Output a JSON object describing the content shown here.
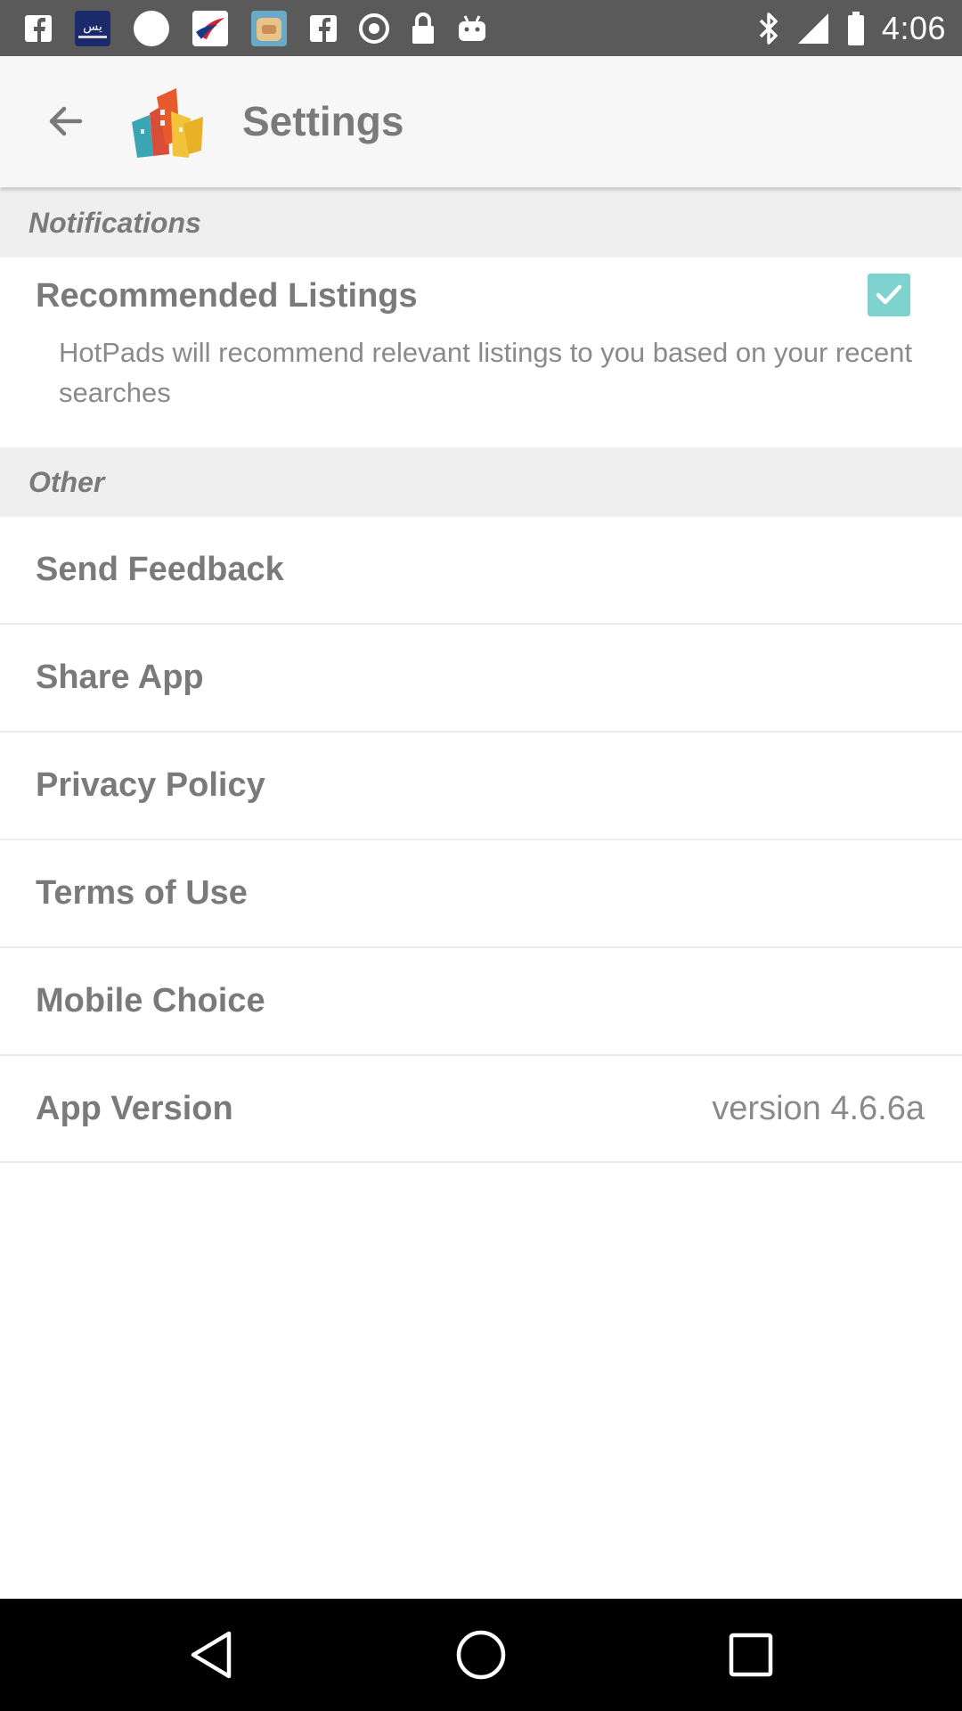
{
  "status_bar": {
    "time": "4:06",
    "icons": [
      "facebook-icon",
      "news-app-icon",
      "circle-icon",
      "airline-app-icon",
      "game-app-icon",
      "facebook-icon",
      "sync-icon",
      "lock-icon",
      "android-icon",
      "bluetooth-icon",
      "signal-icon",
      "battery-icon"
    ]
  },
  "app_bar": {
    "title": "Settings",
    "back_icon": "arrow-back-icon",
    "logo_icon": "hotpads-logo"
  },
  "sections": {
    "notifications": {
      "header": "Notifications"
    },
    "other": {
      "header": "Other"
    }
  },
  "recommended": {
    "title": "Recommended Listings",
    "description": "HotPads will recommend relevant listings to you based on your recent searches",
    "checked": true
  },
  "rows": {
    "send_feedback": "Send Feedback",
    "share_app": "Share App",
    "privacy_policy": "Privacy Policy",
    "terms_of_use": "Terms of Use",
    "mobile_choice": "Mobile Choice",
    "app_version": "App Version",
    "app_version_value": "version 4.6.6a"
  },
  "colors": {
    "status_bar": "#5a5a5a",
    "app_bar": "#f7f7f7",
    "section_bg": "#efefef",
    "text": "#7a7a7a",
    "checkbox": "#7fd3ce",
    "nav_bar": "#000000"
  }
}
